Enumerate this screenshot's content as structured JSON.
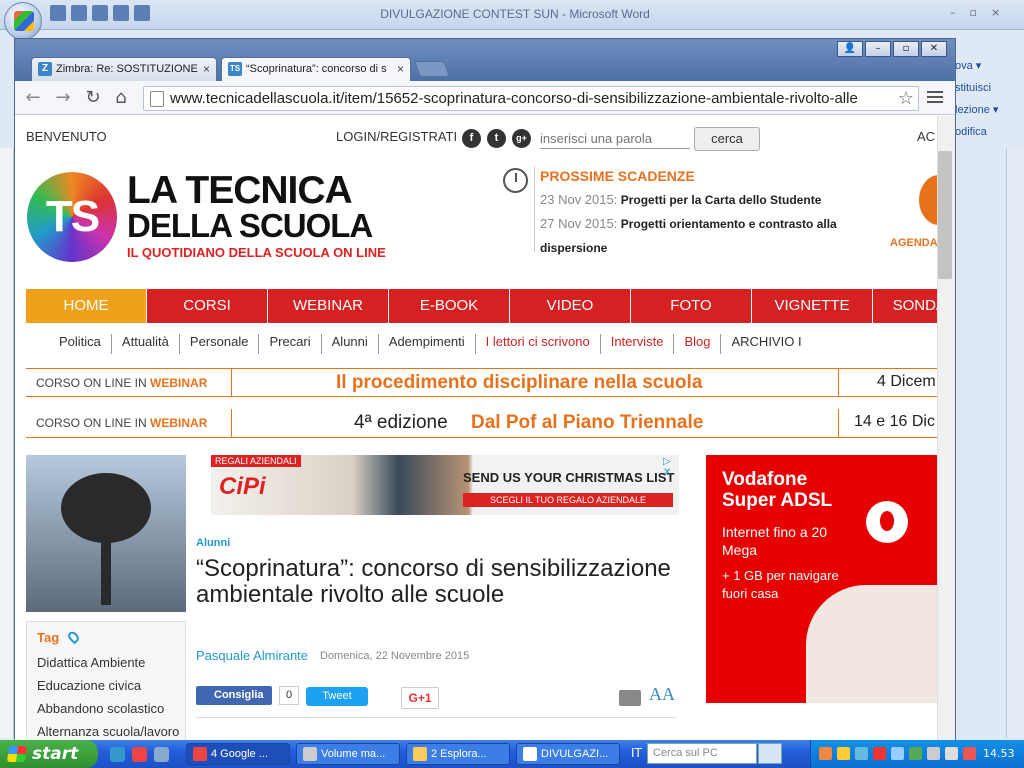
{
  "word": {
    "title": "DIVULGAZIONE CONTEST SUN - Microsoft Word",
    "controls": [
      "–",
      "▫",
      "×"
    ],
    "ribbon_right": [
      "ova ▾",
      "stituisci",
      "lezione ▾",
      "odifica"
    ]
  },
  "chrome": {
    "controls": [
      "👤",
      "–",
      "▫",
      "✕"
    ],
    "tabs": [
      {
        "label": "Zimbra: Re: SOSTITUZIONE",
        "icon": "Z",
        "color": "#3a86c8"
      },
      {
        "label": "“Scoprinatura”: concorso di s",
        "icon": "TS",
        "color": "#3a86c8"
      }
    ],
    "url": "www.tecnicadellascuola.it/item/15652-scoprinatura-concorso-di-sensibilizzazione-ambientale-rivolto-alle",
    "nav_icons": [
      "←",
      "→",
      "↻",
      "⌂"
    ]
  },
  "site": {
    "welcome": "BENVENUTO",
    "login": "LOGIN/REGISTRATI",
    "social": [
      "f",
      "t",
      "g+"
    ],
    "search_placeholder": "inserisci una parola",
    "search_button": "cerca",
    "ac": "AC",
    "logo": {
      "mark": "TS",
      "line1": "LA TECNICA",
      "line2": "DELLA SCUOLA",
      "tagline": "IL QUOTIDIANO DELLA SCUOLA ON LINE"
    },
    "deadlines": {
      "title": "PROSSIME SCADENZE",
      "items": [
        {
          "date": "23 Nov 2015:",
          "text": "Progetti per la Carta dello Studente"
        },
        {
          "date": "27 Nov 2015:",
          "text": "Progetti orientamento e contrasto alla dispersione"
        }
      ]
    },
    "agenda": "AGENDA",
    "main_nav": [
      "HOME",
      "CORSI",
      "WEBINAR",
      "E-BOOK",
      "VIDEO",
      "FOTO",
      "VIGNETTE",
      "SONDAGGI"
    ],
    "sub_nav": [
      {
        "label": "Politica",
        "highlight": false
      },
      {
        "label": "Attualità",
        "highlight": false
      },
      {
        "label": "Personale",
        "highlight": false
      },
      {
        "label": "Precari",
        "highlight": false
      },
      {
        "label": "Alunni",
        "highlight": false
      },
      {
        "label": "Adempimenti",
        "highlight": false
      },
      {
        "label": "I lettori ci scrivono",
        "highlight": true
      },
      {
        "label": "Interviste",
        "highlight": true
      },
      {
        "label": "Blog",
        "highlight": true
      },
      {
        "label": "ARCHIVIO I",
        "highlight": false
      }
    ],
    "banners": [
      {
        "label_prefix": "CORSO ON LINE IN ",
        "label_bold": "WEBINAR",
        "pre": "",
        "title": "Il procedimento disciplinare nella scuola",
        "date": "4 Dicem"
      },
      {
        "label_prefix": "CORSO ON LINE IN ",
        "label_bold": "WEBINAR",
        "pre": "4ª edizione",
        "title": "Dal Pof al Piano Triennale",
        "date": "14 e 16 Dic"
      }
    ],
    "tags": {
      "title": "Tag",
      "items": [
        "Didattica Ambiente",
        "Educazione civica",
        "Abbandono scolastico",
        "Alternanza scuola/lavoro"
      ]
    },
    "ad1": {
      "tag": "REGALI AZIENDALI",
      "brand": "CiPi",
      "headline": "SEND US YOUR CHRISTMAS LIST",
      "cta": "SCEGLI IL TUO REGALO AZIENDALE",
      "close": "▷ ✕"
    },
    "article": {
      "category": "Alunni",
      "title": "“Scoprinatura”: concorso di sensibilizzazione ambientale rivolto alle scuole",
      "author": "Pasquale Almirante",
      "date": "Domenica, 22 Novembre 2015",
      "share": {
        "fb_label": "Consiglia",
        "fb_count": "0",
        "tweet": "Tweet",
        "gplus": "G+1",
        "font_size": "AA"
      }
    },
    "ad2": {
      "brand": "Vodafone Super ADSL",
      "line1": "Internet fino a 20 Mega",
      "line2": "+ 1 GB per navigare fuori casa"
    }
  },
  "taskbar": {
    "start": "start",
    "buttons": [
      {
        "label": "4 Google ...",
        "active": true
      },
      {
        "label": "Volume ma...",
        "active": false
      },
      {
        "label": "2 Esplora...",
        "active": false
      },
      {
        "label": "DIVULGAZI...",
        "active": false
      }
    ],
    "lang": "IT",
    "search_placeholder": "Cerca sul PC",
    "clock": "14.53"
  }
}
